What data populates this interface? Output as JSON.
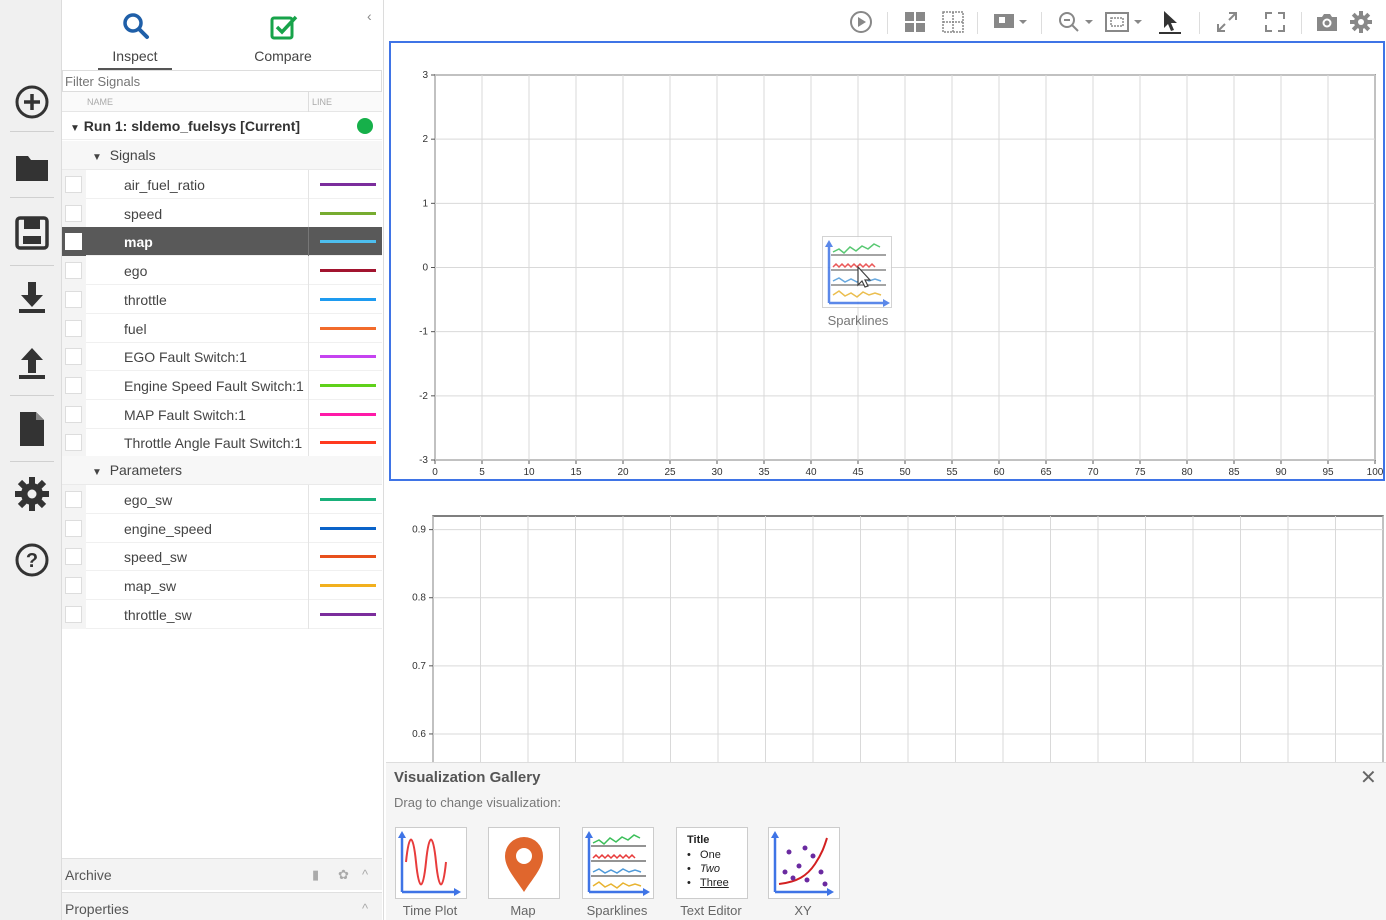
{
  "rail": {
    "items": [
      {
        "name": "add-icon"
      },
      {
        "name": "folder-icon"
      },
      {
        "name": "save-icon"
      },
      {
        "name": "download-icon"
      },
      {
        "name": "upload-icon"
      },
      {
        "name": "document-icon"
      },
      {
        "name": "gear-icon"
      },
      {
        "name": "help-icon"
      }
    ]
  },
  "tabs": {
    "inspect": "Inspect",
    "compare": "Compare",
    "active": "Inspect"
  },
  "filter": {
    "placeholder": "Filter Signals"
  },
  "columns": {
    "name": "NAME",
    "line": "LINE"
  },
  "run": {
    "label": "Run 1: sldemo_fuelsys [Current]",
    "status_color": "#16b04a"
  },
  "groups": {
    "signals": "Signals",
    "parameters": "Parameters"
  },
  "signals": [
    {
      "name": "air_fuel_ratio",
      "color": "#7b2d9c",
      "selected": false
    },
    {
      "name": "speed",
      "color": "#77ac30",
      "selected": false
    },
    {
      "name": "map",
      "color": "#4dbeee",
      "selected": true
    },
    {
      "name": "ego",
      "color": "#a2142f",
      "selected": false
    },
    {
      "name": "throttle",
      "color": "#1e9bf0",
      "selected": false
    },
    {
      "name": "fuel",
      "color": "#f26b2b",
      "selected": false
    },
    {
      "name": "EGO Fault Switch:1",
      "color": "#c543f0",
      "selected": false
    },
    {
      "name": "Engine Speed Fault Switch:1",
      "color": "#5fd11a",
      "selected": false
    },
    {
      "name": "MAP Fault Switch:1",
      "color": "#ff1aa8",
      "selected": false
    },
    {
      "name": "Throttle Angle Fault Switch:1",
      "color": "#ff3a1f",
      "selected": false
    }
  ],
  "parameters": [
    {
      "name": "ego_sw",
      "color": "#19b07a",
      "selected": false
    },
    {
      "name": "engine_speed",
      "color": "#0a63c9",
      "selected": false
    },
    {
      "name": "speed_sw",
      "color": "#e8501c",
      "selected": false
    },
    {
      "name": "map_sw",
      "color": "#f2b01e",
      "selected": false
    },
    {
      "name": "throttle_sw",
      "color": "#7b2d9c",
      "selected": false
    }
  ],
  "bottom": {
    "archive": "Archive",
    "properties": "Properties"
  },
  "toolbar": {
    "buttons": [
      "play-icon",
      "layout-grid-icon",
      "subplot-layout-icon",
      "legend-icon",
      "zoom-icon",
      "zoom-fit-icon",
      "cursor-icon",
      "expand-icon",
      "fullscreen-icon",
      "camera-icon",
      "settings-icon"
    ]
  },
  "plot1": {
    "xlim": [
      0,
      100
    ],
    "ylim": [
      -3,
      3
    ],
    "xticks": [
      "0",
      "5",
      "10",
      "15",
      "20",
      "25",
      "30",
      "35",
      "40",
      "45",
      "50",
      "55",
      "60",
      "65",
      "70",
      "75",
      "80",
      "85",
      "90",
      "95",
      "100"
    ],
    "yticks": [
      "3",
      "2",
      "1",
      "0",
      "-1",
      "-2",
      "-3"
    ]
  },
  "plot2": {
    "ylim": [
      0.55,
      0.92
    ],
    "yticks": [
      "0.9",
      "0.8",
      "0.7",
      "0.6"
    ]
  },
  "dragging": {
    "label": "Sparklines"
  },
  "gallery": {
    "title": "Visualization Gallery",
    "subtitle": "Drag to change visualization:",
    "items": [
      {
        "label": "Time Plot"
      },
      {
        "label": "Map"
      },
      {
        "label": "Sparklines"
      },
      {
        "label": "Text Editor",
        "lines": {
          "title": "Title",
          "one": "One",
          "two": "Two",
          "three": "Three"
        }
      },
      {
        "label": "XY"
      }
    ]
  }
}
